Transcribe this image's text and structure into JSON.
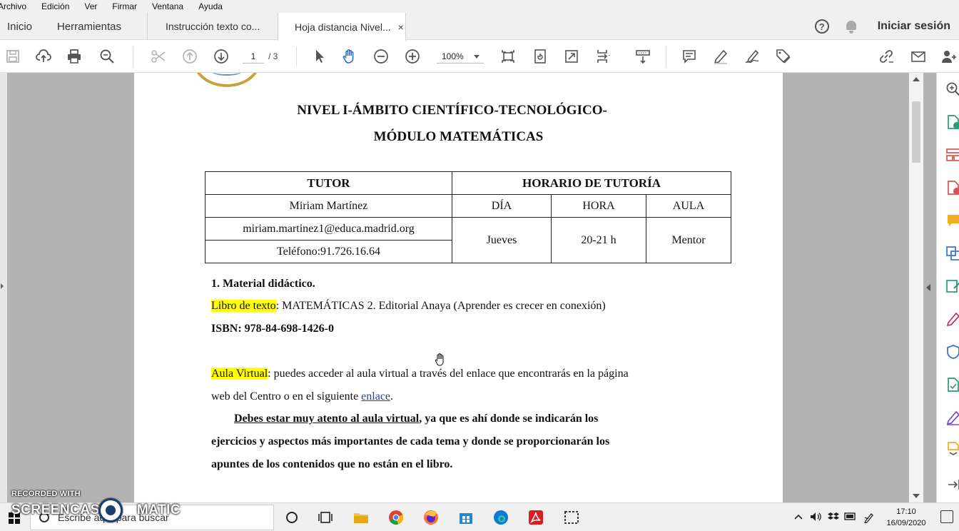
{
  "menu": [
    "Archivo",
    "Edición",
    "Ver",
    "Firmar",
    "Ventana",
    "Ayuda"
  ],
  "tabs": {
    "home": "Inicio",
    "tools": "Herramientas",
    "doc1": "Instrucción texto co...",
    "doc2": "Hoja distancia Nivel...",
    "close_glyph": "×"
  },
  "header": {
    "signin": "Iniciar sesión",
    "help_glyph": "?"
  },
  "toolbar": {
    "page_current": "1",
    "page_total": "/ 3",
    "zoom": "100%"
  },
  "document": {
    "title_line1": "NIVEL I-ÁMBITO CIENTÍFICO-TECNOLÓGICO-",
    "title_line2": "MÓDULO MATEMÁTICAS",
    "table": {
      "tutor_header": "TUTOR",
      "schedule_header": "HORARIO DE TUTORÍA",
      "tutor_name": "Miriam Martínez",
      "tutor_email": "miriam.martinez1@educa.madrid.org",
      "tutor_phone": "Teléfono:91.726.16.64",
      "col_day": "DÍA",
      "col_hour": "HORA",
      "col_room": "AULA",
      "day": "Jueves",
      "hour": "20-21 h",
      "room": "Mentor"
    },
    "section1_title": "1.  Material didáctico.",
    "textbook_label": "Libro de texto",
    "textbook_text": ": MATEMÁTICAS 2. Editorial Anaya (Aprender es crecer en conexión)",
    "isbn": "ISBN: 978-84-698-1426-0",
    "virtual_label": "Aula Virtual",
    "virtual_text": ": puedes acceder al aula virtual a través del enlace que encontrarás en la página",
    "virtual_text2": "web del Centro o en el siguiente ",
    "virtual_link": "enlace",
    "virtual_period": ".",
    "warning_ul": "Debes estar muy atento al aula virtual",
    "warning_rest": ", ya que es ahí donde se indicarán los",
    "warning_line2": "ejercicios y aspectos más importantes de cada tema y donde se proporcionarán los",
    "warning_line3": "apuntes de los contenidos que no están en el libro."
  },
  "taskbar": {
    "search_placeholder": "Escribe aquí para buscar",
    "time": "17:10",
    "date": "16/09/2020"
  },
  "watermark": {
    "line1": "RECORDED WITH",
    "line2": "SCREENCAST",
    "line3": "MATIC"
  },
  "colors": {
    "highlight": "#ffff00",
    "link": "#1f3fb0",
    "accent": "#2f6fcf",
    "workarea": "#b3b3b3"
  }
}
